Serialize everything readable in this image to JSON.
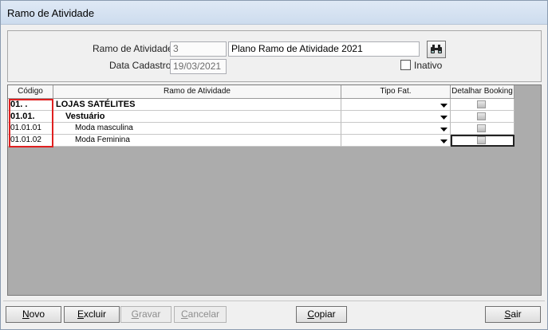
{
  "window": {
    "title": "Ramo de Atividade"
  },
  "form": {
    "ramo_label": "Ramo de Atividade:",
    "ramo_code": "3",
    "ramo_name": "Plano Ramo de Atividade 2021",
    "data_label": "Data Cadastro:",
    "data_value": "19/03/2021",
    "inativo_label": "Inativo",
    "inativo_checked": false,
    "find_icon": "binoculars-icon"
  },
  "grid": {
    "headers": [
      "Código",
      "Ramo de Atividade",
      "Tipo Fat.",
      "Detalhar Booking"
    ],
    "rows": [
      {
        "code": "01. .",
        "name": "LOJAS SATÉLITES",
        "tipo": "",
        "detalhar": false,
        "bold": true
      },
      {
        "code": "01.01.",
        "name": "Vestuário",
        "tipo": "",
        "detalhar": false,
        "bold": true
      },
      {
        "code": "01.01.01",
        "name": "Moda masculina",
        "tipo": "",
        "detalhar": false,
        "bold": false
      },
      {
        "code": "01.01.02",
        "name": "Moda Feminina",
        "tipo": "",
        "detalhar": false,
        "bold": false
      }
    ]
  },
  "buttons": {
    "novo": {
      "first": "N",
      "rest": "ovo"
    },
    "excluir": {
      "first": "E",
      "rest": "xcluir"
    },
    "gravar": {
      "first": "G",
      "rest": "ravar"
    },
    "cancelar": {
      "first": "C",
      "rest": "ancelar"
    },
    "copiar": {
      "first": "C",
      "rest": "opiar"
    },
    "sair": {
      "first": "S",
      "rest": "air"
    }
  },
  "colors": {
    "highlight": "#e02020"
  }
}
